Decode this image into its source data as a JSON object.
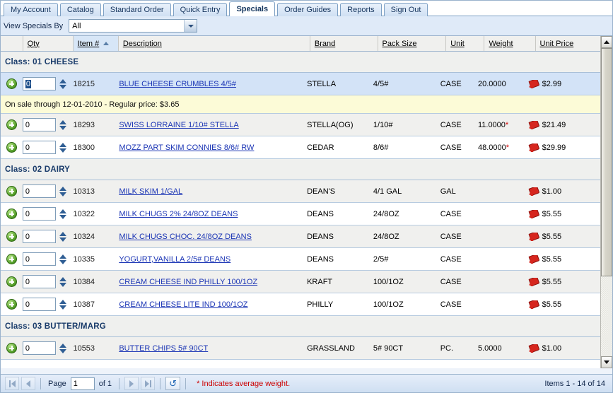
{
  "tabs": [
    {
      "label": "My Account",
      "active": false
    },
    {
      "label": "Catalog",
      "active": false
    },
    {
      "label": "Standard Order",
      "active": false
    },
    {
      "label": "Quick Entry",
      "active": false
    },
    {
      "label": "Specials",
      "active": true
    },
    {
      "label": "Order Guides",
      "active": false
    },
    {
      "label": "Reports",
      "active": false
    },
    {
      "label": "Sign Out",
      "active": false
    }
  ],
  "filter": {
    "label": "View Specials By",
    "selected": "All",
    "options": [
      "All"
    ]
  },
  "columns": [
    {
      "key": "plus",
      "label": ""
    },
    {
      "key": "qty",
      "label": "Qty"
    },
    {
      "key": "item",
      "label": "Item #",
      "sorted": true,
      "sort_dir": "asc"
    },
    {
      "key": "desc",
      "label": "Description"
    },
    {
      "key": "brand",
      "label": "Brand"
    },
    {
      "key": "pack",
      "label": "Pack Size"
    },
    {
      "key": "unit",
      "label": "Unit"
    },
    {
      "key": "weight",
      "label": "Weight"
    },
    {
      "key": "price",
      "label": "Unit Price"
    }
  ],
  "rows": [
    {
      "type": "class",
      "label": "Class: 01 CHEESE"
    },
    {
      "type": "item",
      "qty": "0",
      "focused": true,
      "item": "18215",
      "desc": "BLUE CHEESE CRUMBLES 4/5#",
      "brand": "STELLA",
      "pack": "4/5#",
      "unit": "CASE",
      "weight": "20.0000",
      "avg": false,
      "price": "$2.99",
      "shade": "sel"
    },
    {
      "type": "note",
      "text": "On sale through 12-01-2010 - Regular price: $3.65"
    },
    {
      "type": "item",
      "qty": "0",
      "focused": false,
      "item": "18293",
      "desc": "SWISS LORRAINE 1/10# STELLA",
      "brand": "STELLA(OG)",
      "pack": "1/10#",
      "unit": "CASE",
      "weight": "11.0000",
      "avg": true,
      "price": "$21.49",
      "shade": "alt"
    },
    {
      "type": "item",
      "qty": "0",
      "focused": false,
      "item": "18300",
      "desc": "MOZZ PART SKIM CONNIES 8/6# RW",
      "brand": "CEDAR",
      "pack": "8/6#",
      "unit": "CASE",
      "weight": "48.0000",
      "avg": true,
      "price": "$29.99",
      "shade": "white"
    },
    {
      "type": "class",
      "label": "Class: 02 DAIRY"
    },
    {
      "type": "item",
      "qty": "0",
      "focused": false,
      "item": "10313",
      "desc": "MILK SKIM 1/GAL",
      "brand": "DEAN'S",
      "pack": "4/1 GAL",
      "unit": "GAL",
      "weight": "",
      "avg": false,
      "price": "$1.00",
      "shade": "alt"
    },
    {
      "type": "item",
      "qty": "0",
      "focused": false,
      "item": "10322",
      "desc": "MILK CHUGS 2% 24/8OZ DEANS",
      "brand": "DEANS",
      "pack": "24/8OZ",
      "unit": "CASE",
      "weight": "",
      "avg": false,
      "price": "$5.55",
      "shade": "white"
    },
    {
      "type": "item",
      "qty": "0",
      "focused": false,
      "item": "10324",
      "desc": "MILK CHUGS CHOC. 24/8OZ DEANS",
      "brand": "DEANS",
      "pack": "24/8OZ",
      "unit": "CASE",
      "weight": "",
      "avg": false,
      "price": "$5.55",
      "shade": "alt"
    },
    {
      "type": "item",
      "qty": "0",
      "focused": false,
      "item": "10335",
      "desc": "YOGURT,VANILLA 2/5# DEANS",
      "brand": "DEANS",
      "pack": "2/5#",
      "unit": "CASE",
      "weight": "",
      "avg": false,
      "price": "$5.55",
      "shade": "white"
    },
    {
      "type": "item",
      "qty": "0",
      "focused": false,
      "item": "10384",
      "desc": "CREAM CHEESE IND PHILLY 100/1OZ",
      "brand": "KRAFT",
      "pack": "100/1OZ",
      "unit": "CASE",
      "weight": "",
      "avg": false,
      "price": "$5.55",
      "shade": "alt"
    },
    {
      "type": "item",
      "qty": "0",
      "focused": false,
      "item": "10387",
      "desc": "CREAM CHEESE LITE IND 100/1OZ",
      "brand": "PHILLY",
      "pack": "100/1OZ",
      "unit": "CASE",
      "weight": "",
      "avg": false,
      "price": "$5.55",
      "shade": "white"
    },
    {
      "type": "class",
      "label": "Class: 03 BUTTER/MARG"
    },
    {
      "type": "item",
      "qty": "0",
      "focused": false,
      "item": "10553",
      "desc": "BUTTER CHIPS 5# 90CT",
      "brand": "GRASSLAND",
      "pack": "5# 90CT",
      "unit": "PC.",
      "weight": "5.0000",
      "avg": false,
      "price": "$1.00",
      "shade": "alt"
    }
  ],
  "statusbar": {
    "first_label": "first-page",
    "prev_label": "previous-page",
    "page_label": "Page",
    "page_value": "1",
    "of_label": "of 1",
    "next_label": "next-page",
    "last_label": "last-page",
    "refresh_label": "refresh",
    "avg_note": "* Indicates average weight.",
    "item_count": "Items 1 - 14 of 14"
  },
  "colors": {
    "accent": "#1b35b5",
    "class_header": "#1a3c6b",
    "note_bg": "#fcfbd7",
    "selected_row": "#d3e3f7",
    "warning_red": "#cc0000",
    "tag_red": "#d6261e",
    "plus_green": "#4f9a25"
  }
}
